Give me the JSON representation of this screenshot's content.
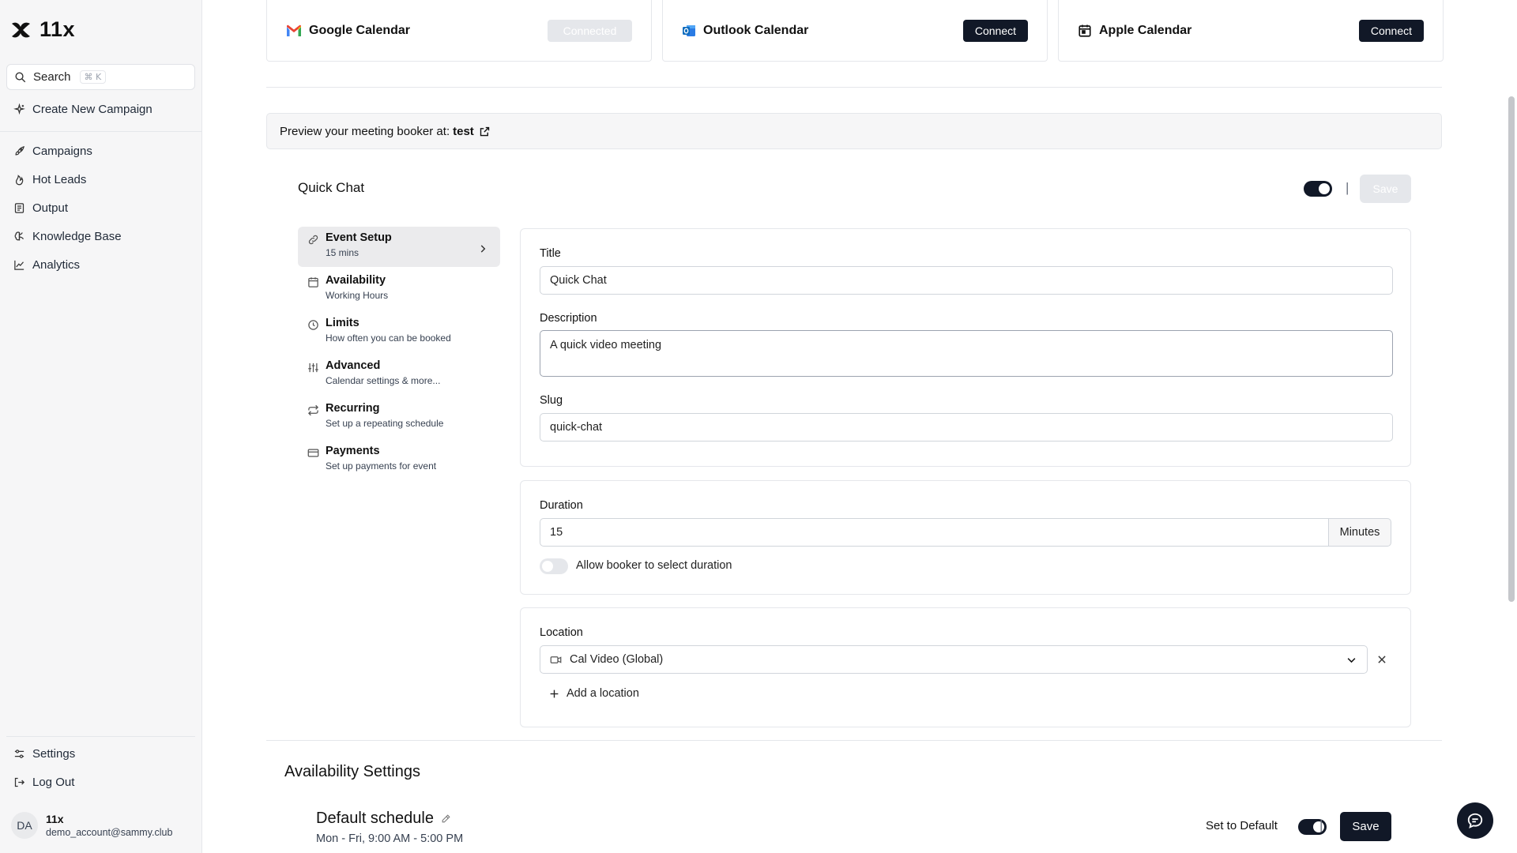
{
  "sidebar": {
    "brand": "11x",
    "search": {
      "label": "Search",
      "shortcut": "⌘ K"
    },
    "create_campaign": "Create New Campaign",
    "items": [
      {
        "label": "Campaigns",
        "icon": "rocket-icon"
      },
      {
        "label": "Hot Leads",
        "icon": "flame-icon"
      },
      {
        "label": "Output",
        "icon": "document-icon"
      },
      {
        "label": "Knowledge Base",
        "icon": "brain-icon"
      },
      {
        "label": "Analytics",
        "icon": "chart-icon"
      }
    ],
    "settings": "Settings",
    "logout": "Log Out",
    "user": {
      "initials": "DA",
      "name": "11x",
      "email": "demo_account@sammy.club"
    }
  },
  "calendars": [
    {
      "name": "Google Calendar",
      "button": "Connected",
      "state": "connected"
    },
    {
      "name": "Outlook Calendar",
      "button": "Connect",
      "state": "disconnected"
    },
    {
      "name": "Apple Calendar",
      "button": "Connect",
      "state": "disconnected"
    }
  ],
  "preview": {
    "text": "Preview your meeting booker at:",
    "link": "test"
  },
  "event": {
    "title": "Quick Chat",
    "enabled": true,
    "save_label": "Save",
    "tabs": [
      {
        "title": "Event Setup",
        "subtitle": "15 mins",
        "active": true
      },
      {
        "title": "Availability",
        "subtitle": "Working Hours"
      },
      {
        "title": "Limits",
        "subtitle": "How often you can be booked"
      },
      {
        "title": "Advanced",
        "subtitle": "Calendar settings & more..."
      },
      {
        "title": "Recurring",
        "subtitle": "Set up a repeating schedule"
      },
      {
        "title": "Payments",
        "subtitle": "Set up payments for event"
      }
    ],
    "form": {
      "title_label": "Title",
      "title_value": "Quick Chat",
      "description_label": "Description",
      "description_value": "A quick video meeting",
      "slug_label": "Slug",
      "slug_value": "quick-chat",
      "duration_label": "Duration",
      "duration_value": "15",
      "duration_unit": "Minutes",
      "allow_select_duration": "Allow booker to select duration",
      "location_label": "Location",
      "location_value": "Cal Video (Global)",
      "add_location": "Add a location"
    }
  },
  "availability": {
    "heading": "Availability Settings",
    "schedule_name": "Default schedule",
    "schedule_hours": "Mon - Fri, 9:00 AM - 5:00 PM",
    "set_default": "Set to Default",
    "save_label": "Save"
  },
  "colors": {
    "accent": "#111827",
    "muted": "#e5e7eb",
    "sidebar_bg": "#f6f6f7"
  }
}
